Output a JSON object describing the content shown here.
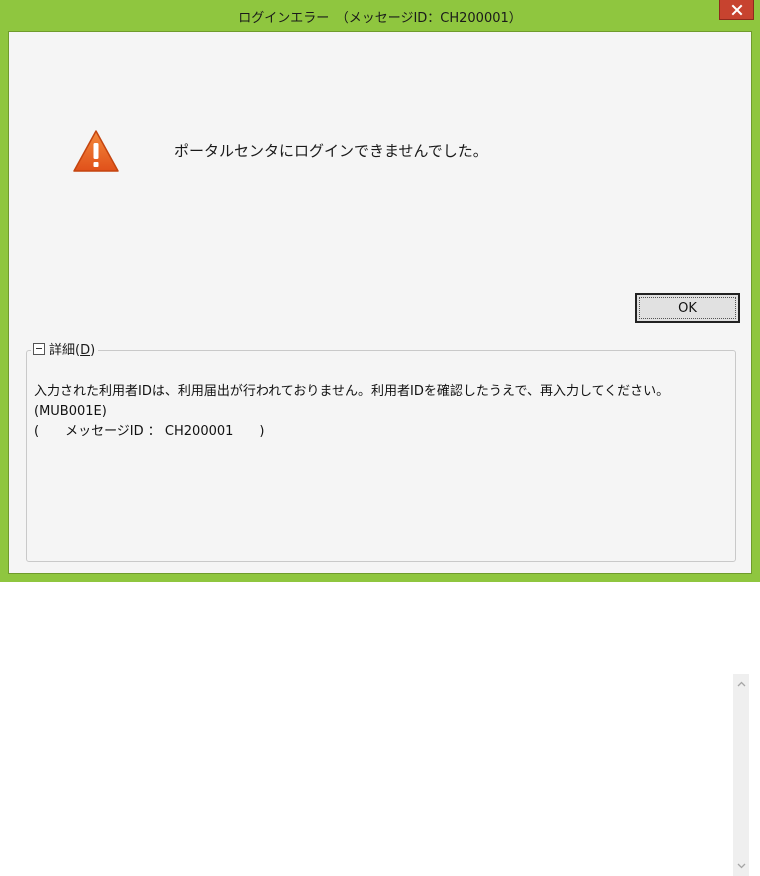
{
  "window": {
    "title": "ログインエラー　（メッセージID：CH200001）"
  },
  "colors": {
    "frame": "#8fc63f",
    "close_button": "#c7432f",
    "client_bg": "#f5f5f5",
    "warning": "#e8601e"
  },
  "icons": {
    "warning": "warning-icon",
    "close": "close-icon",
    "collapse": "collapse-icon",
    "scroll_up": "chevron-up-icon",
    "scroll_down": "chevron-down-icon"
  },
  "main": {
    "message": "ポータルセンタにログインできませんでした。",
    "ok_label": "OK"
  },
  "details": {
    "label": "詳細(",
    "accelerator": "D",
    "label_close": ")",
    "lines": [
      "入力された利用者IDは、利用届出が行われておりません。利用者IDを確認したうえで、再入力してください。",
      "(MUB001E)",
      "",
      "(　　メッセージID ： CH200001　　)"
    ]
  }
}
